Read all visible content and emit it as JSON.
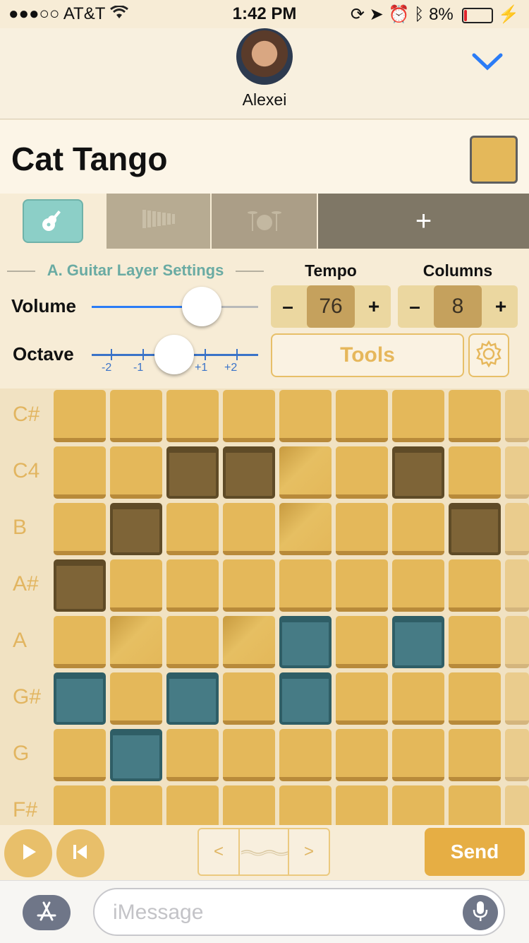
{
  "status_bar": {
    "signal": "●●●○○",
    "carrier": "AT&T",
    "time": "1:42 PM",
    "battery_pct": "8%"
  },
  "contact": {
    "name": "Alexei"
  },
  "song": {
    "title": "Cat Tango",
    "color": "#e4b85a"
  },
  "tabs": {
    "items": [
      {
        "name": "guitar",
        "icon": "guitar-icon",
        "active": true
      },
      {
        "name": "xylophone",
        "icon": "xylophone-icon",
        "active": false
      },
      {
        "name": "drums",
        "icon": "drums-icon",
        "active": false
      }
    ],
    "add_label": "+"
  },
  "settings": {
    "title": "A. Guitar Layer Settings",
    "volume_label": "Volume",
    "volume_level": 0.66,
    "octave_label": "Octave",
    "octave_ticks": [
      "-2",
      "-1",
      "+1",
      "+2"
    ],
    "octave_value": 0
  },
  "tempo": {
    "label": "Tempo",
    "minus": "–",
    "value": "76",
    "plus": "+"
  },
  "columns": {
    "label": "Columns",
    "minus": "–",
    "value": "8",
    "plus": "+"
  },
  "tools_label": "Tools",
  "grid": {
    "notes": [
      "C#",
      "C4",
      "B",
      "A#",
      "A",
      "G#",
      "G",
      "F#"
    ],
    "legend": {
      "o": "off",
      "d": "on",
      "t": "teal",
      "s": "shine"
    },
    "rows": [
      "oooooooo",
      "ooddsodo",
      "odoosood",
      "doooooooo",
      "osostotoo",
      "tototooo",
      "otoooooo",
      "oooooooo"
    ]
  },
  "controls": {
    "play_icon": "play-icon",
    "rewind_icon": "skip-back-icon",
    "pager_prev": "<",
    "pager_next": ">",
    "send_label": "Send"
  },
  "imessage": {
    "placeholder": "iMessage"
  }
}
